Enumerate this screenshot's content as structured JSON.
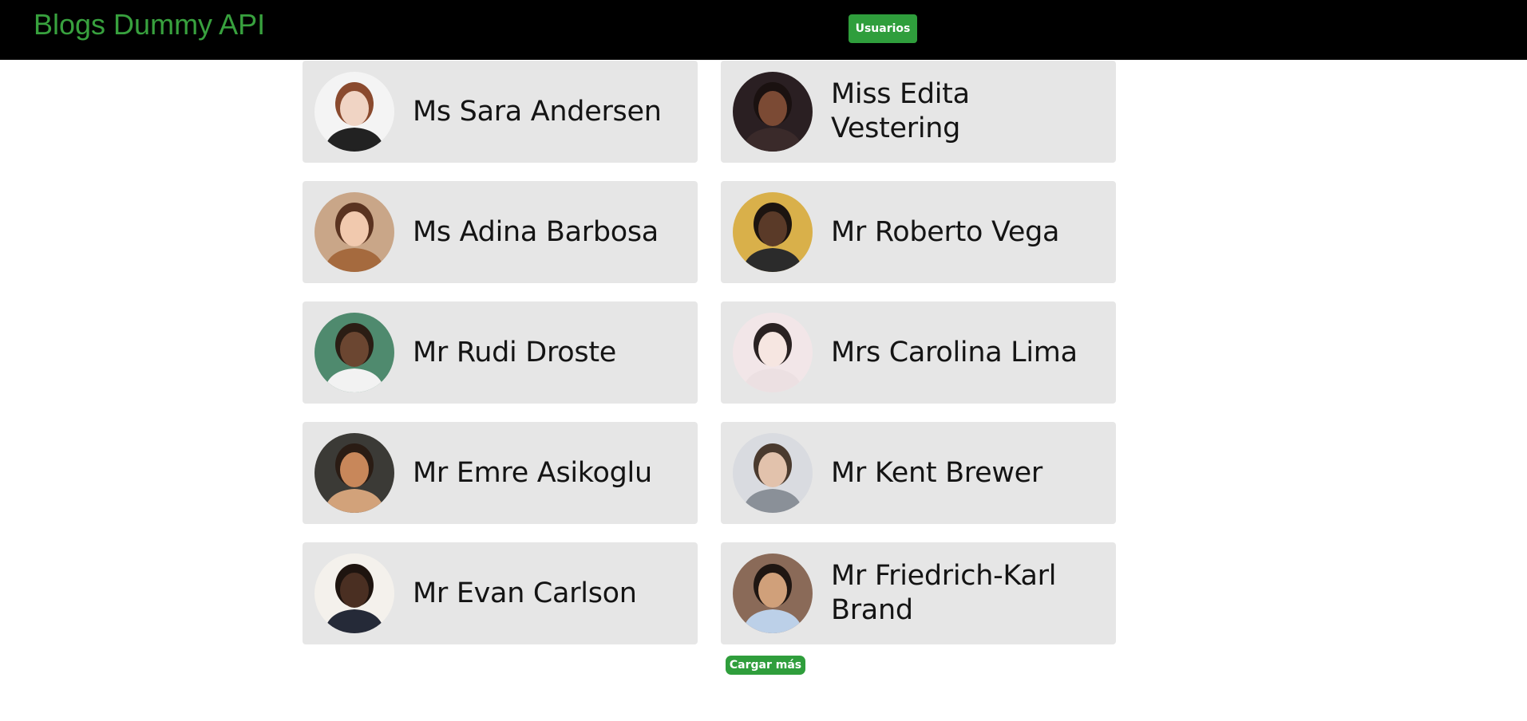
{
  "navbar": {
    "brand": "Blogs Dummy API",
    "users_button": "Usuarios",
    "brand_color": "#38a13e",
    "background": "#000000"
  },
  "users": [
    {
      "name": "Ms Sara Andersen",
      "avatar_bg": "#f4f4f4",
      "skin": "#f0d4c4",
      "hair": "#8a4a2e",
      "cloth": "#222222"
    },
    {
      "name": "Miss Edita Vestering",
      "avatar_bg": "#2a1f22",
      "skin": "#7b4a34",
      "hair": "#1a1110",
      "cloth": "#3a2a2a"
    },
    {
      "name": "Ms Adina Barbosa",
      "avatar_bg": "#c9a688",
      "skin": "#f1c9ae",
      "hair": "#5a3320",
      "cloth": "#a56a3e"
    },
    {
      "name": "Mr Roberto Vega",
      "avatar_bg": "#d9b04a",
      "skin": "#5a3a28",
      "hair": "#1c1410",
      "cloth": "#2b2b2b"
    },
    {
      "name": "Mr Rudi Droste",
      "avatar_bg": "#4f8a6e",
      "skin": "#6b4631",
      "hair": "#2b1d14",
      "cloth": "#f2f2f2"
    },
    {
      "name": "Mrs Carolina Lima",
      "avatar_bg": "#f2e6e8",
      "skin": "#f6e6e1",
      "hair": "#2a2222",
      "cloth": "#ece0e2"
    },
    {
      "name": "Mr Emre Asikoglu",
      "avatar_bg": "#3b3a36",
      "skin": "#c8875a",
      "hair": "#2a1c14",
      "cloth": "#d2a27a"
    },
    {
      "name": "Mr Kent Brewer",
      "avatar_bg": "#d9dbe0",
      "skin": "#e2c2ac",
      "hair": "#4a3a2e",
      "cloth": "#8a9098"
    },
    {
      "name": "Mr Evan Carlson",
      "avatar_bg": "#f4f1ec",
      "skin": "#4a2f22",
      "hair": "#1e140f",
      "cloth": "#252a38"
    },
    {
      "name": "Mr Friedrich-Karl Brand",
      "avatar_bg": "#8a6a58",
      "skin": "#d0a07a",
      "hair": "#1f1612",
      "cloth": "#bcd0e8"
    }
  ],
  "load_more_button": "Cargar más",
  "accent_color": "#2f9e3c",
  "card_background": "#e6e6e6"
}
